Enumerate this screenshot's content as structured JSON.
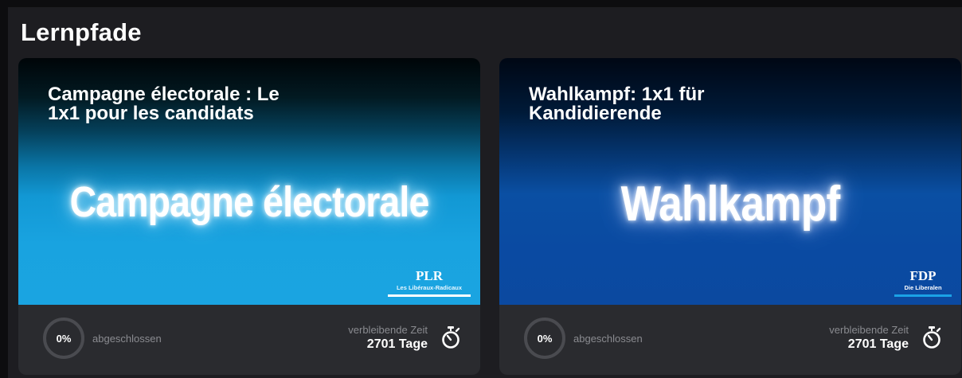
{
  "section": {
    "title": "Lernpfade"
  },
  "cards": [
    {
      "title_line1": "Campagne électorale : Le",
      "title_line2": "1x1 pour les candidats",
      "banner_text": "Campagne électorale",
      "logo_main": "PLR",
      "logo_sub": "Les Libéraux-Radicaux",
      "progress": "0%",
      "progress_label": "abgeschlossen",
      "time_label": "verbleibende Zeit",
      "time_value": "2701 Tage",
      "icon": "stopwatch-icon"
    },
    {
      "title_line1": "Wahlkampf: 1x1 für",
      "title_line2": "Kandidierende",
      "banner_text": "Wahlkampf",
      "logo_main": "FDP",
      "logo_sub": "Die Liberalen",
      "progress": "0%",
      "progress_label": "abgeschlossen",
      "time_label": "verbleibende Zeit",
      "time_value": "2701 Tage",
      "icon": "stopwatch-icon"
    }
  ],
  "colors": {
    "background": "#1d1d21",
    "card_footer": "#2a2b2f",
    "card1_banner": "#1aa4e1",
    "card2_banner": "#0b49a0",
    "fdp_accent": "#1ba2e6",
    "muted_text": "#8a8b90"
  }
}
